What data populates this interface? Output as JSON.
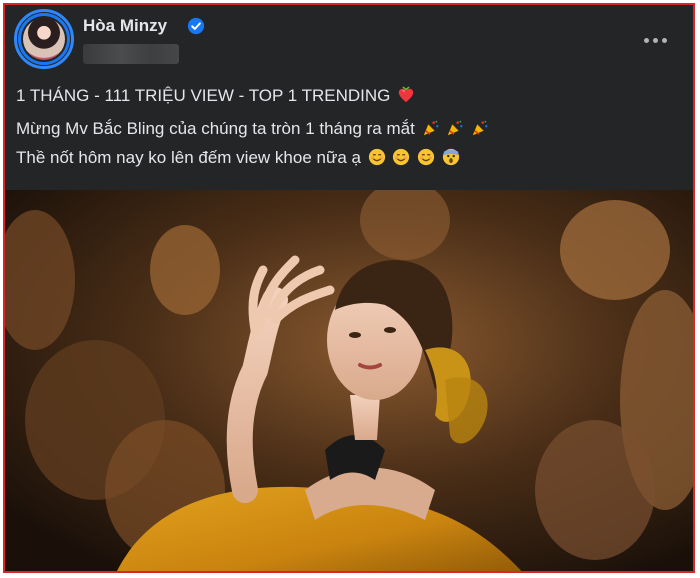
{
  "post": {
    "author": {
      "name": "Hòa Minzy",
      "verified": true
    },
    "text": {
      "headline": "1 THÁNG - 111 TRIỆU VIEW - TOP 1 TRENDING",
      "line1": "Mừng Mv Bắc Bling của chúng ta tròn 1 tháng ra mắt",
      "line2": "Thề nốt hôm nay ko lên đếm view khoe nữa ạ"
    },
    "icons": {
      "headline_emoji": "red-heart-gem-icon",
      "line1_emoji": "party-popper-icon",
      "line2_emoji": "smiling-face-icon",
      "line2_last_emoji": "screaming-face-icon"
    }
  },
  "colors": {
    "background": "#242526",
    "text": "#e4e6eb",
    "verified": "#1877f2",
    "frame_border": "#d8262b"
  }
}
